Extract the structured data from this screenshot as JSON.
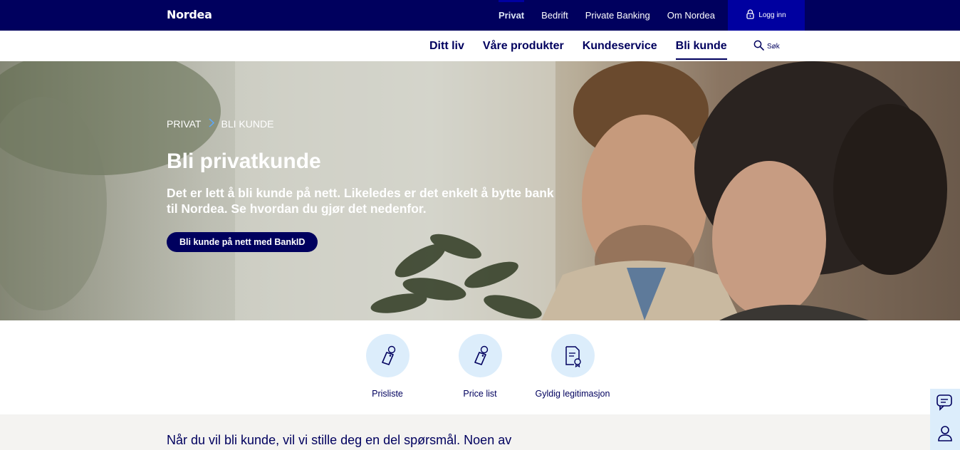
{
  "brand": {
    "logo": "Nordea"
  },
  "colors": {
    "navy": "#00005e",
    "blue_accent": "#0000a0",
    "light_blue": "#dcedfb"
  },
  "segments": [
    {
      "label": "Privat",
      "active": true
    },
    {
      "label": "Bedrift",
      "active": false
    },
    {
      "label": "Private Banking",
      "active": false
    },
    {
      "label": "Om Nordea",
      "active": false
    }
  ],
  "login": {
    "label": "Logg inn",
    "icon": "lock-icon"
  },
  "subnav": {
    "items": [
      {
        "label": "Ditt liv",
        "active": false
      },
      {
        "label": "Våre produkter",
        "active": false
      },
      {
        "label": "Kundeservice",
        "active": false
      },
      {
        "label": "Bli kunde",
        "active": true
      }
    ],
    "search_label": "Søk",
    "search_icon": "search-icon"
  },
  "hero": {
    "breadcrumbs": [
      "PRIVAT",
      "BLI KUNDE"
    ],
    "title": "Bli privatkunde",
    "subtitle": "Det er lett å bli kunde på nett. Likeledes er det enkelt å bytte bank til Nordea. Se hvordan du gjør det nedenfor.",
    "cta_label": "Bli kunde på nett med BankID"
  },
  "quick_links": [
    {
      "label": "Prisliste",
      "icon": "price-tag-icon"
    },
    {
      "label": "Price list",
      "icon": "price-tag-icon"
    },
    {
      "label": "Gyldig legitimasjon",
      "icon": "certificate-document-icon"
    }
  ],
  "body": {
    "intro": "Når du vil bli kunde, vil vi stille deg en del spørsmål. Noen av"
  },
  "widget": {
    "chat_icon": "chat-icon",
    "contact_icon": "person-icon"
  }
}
